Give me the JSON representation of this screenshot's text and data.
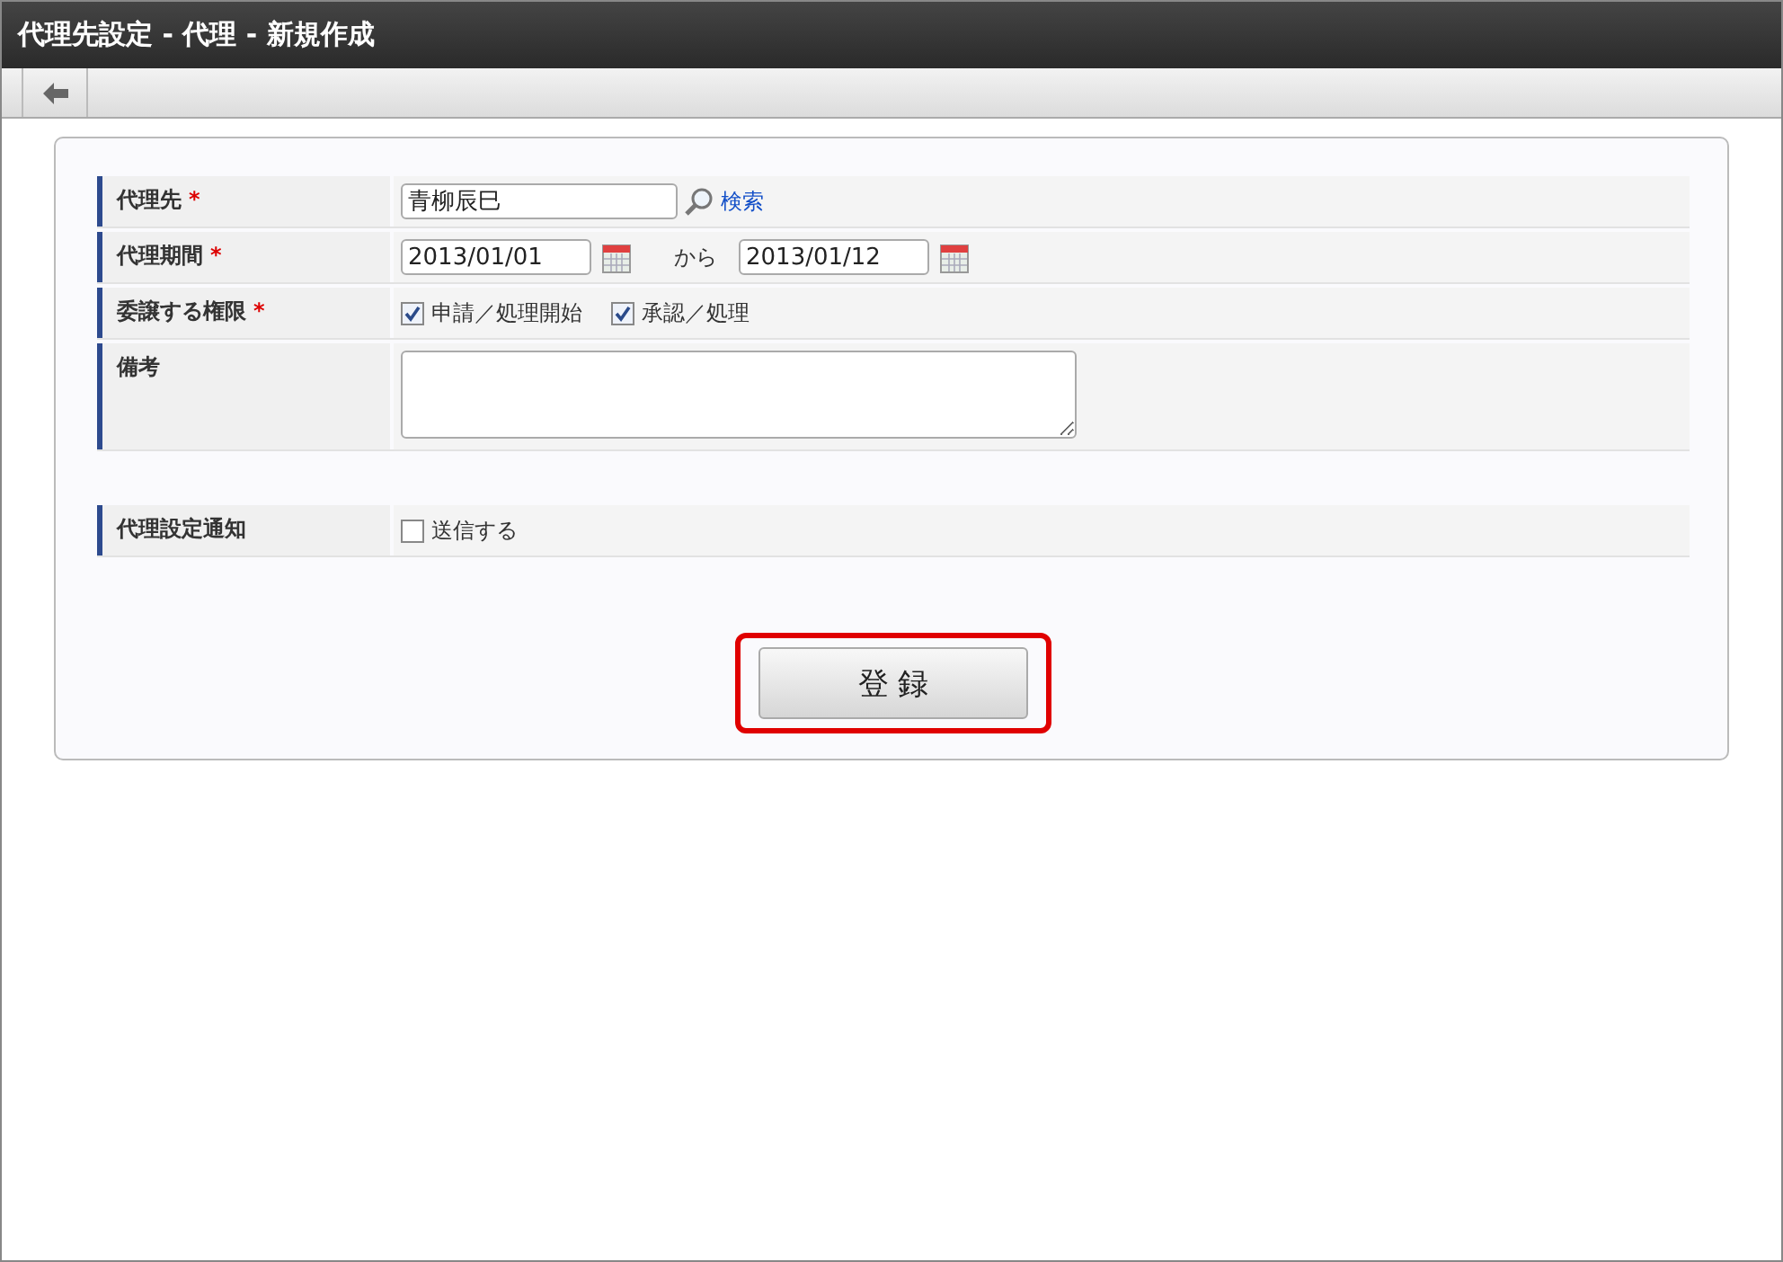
{
  "window": {
    "title": "代理先設定 - 代理 - 新規作成"
  },
  "form": {
    "rows": [
      {
        "kind": "search",
        "label": "代理先",
        "mark": "*",
        "value": "青柳辰巳",
        "link": "検索"
      },
      {
        "kind": "daterange",
        "label": "代理期間",
        "mark": "*",
        "from": "2013/01/01",
        "separator": "から",
        "to": "2013/01/12"
      },
      {
        "kind": "checks",
        "label": "委譲する権限",
        "mark": "*",
        "options": [
          {
            "label": "申請／処理開始",
            "checked": true
          },
          {
            "label": "承認／処理",
            "checked": true
          }
        ]
      },
      {
        "kind": "textarea",
        "label": "備考"
      }
    ],
    "notify_rows": [
      {
        "kind": "checks",
        "label": "代理設定通知",
        "options": [
          {
            "label": "送信する",
            "checked": false
          }
        ]
      }
    ]
  },
  "submit": {
    "label": "登 録",
    "highlighted": true
  }
}
